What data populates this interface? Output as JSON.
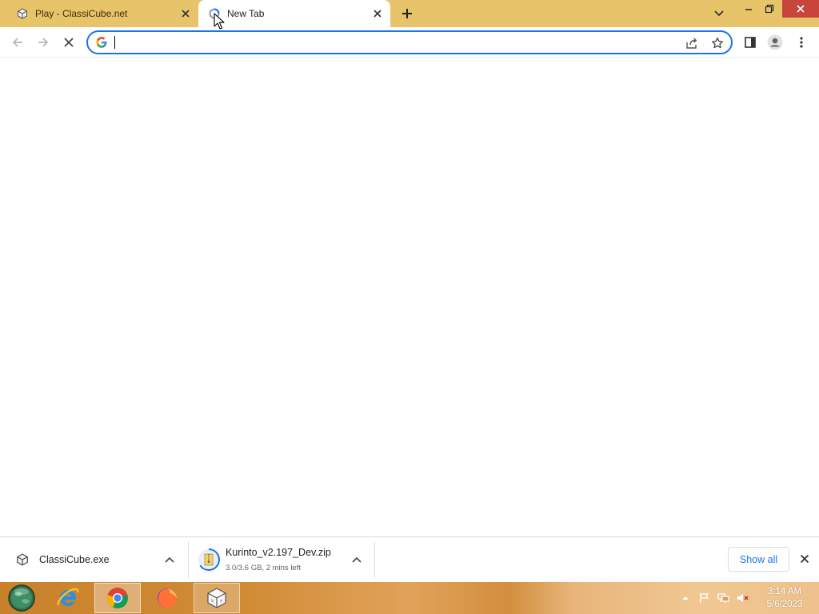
{
  "browser": {
    "tabs": [
      {
        "title": "Play - ClassiCube.net",
        "favicon": "classicube-cube-icon",
        "active": false
      },
      {
        "title": "New Tab",
        "favicon": "loading-spinner-icon",
        "active": true
      }
    ],
    "new_tab_symbol": "+",
    "omnibox": {
      "value": "",
      "placeholder": ""
    },
    "colors": {
      "tabstrip": "#e7c36a",
      "accent": "#1a73e8",
      "window_close": "#c7453a"
    }
  },
  "downloads": {
    "items": [
      {
        "name": "ClassiCube.exe",
        "status": "",
        "icon": "classicube-cube-icon"
      },
      {
        "name": "Kurinto_v2.197_Dev.zip",
        "status": "3.0/3.6 GB, 2 mins left",
        "icon": "zip-archive-icon"
      }
    ],
    "show_all_label": "Show all"
  },
  "taskbar": {
    "apps": [
      "internet-explorer-icon",
      "chrome-icon",
      "firefox-icon",
      "classicube-icon"
    ],
    "clock": {
      "time": "3:14 AM",
      "date": "5/6/2023"
    }
  }
}
